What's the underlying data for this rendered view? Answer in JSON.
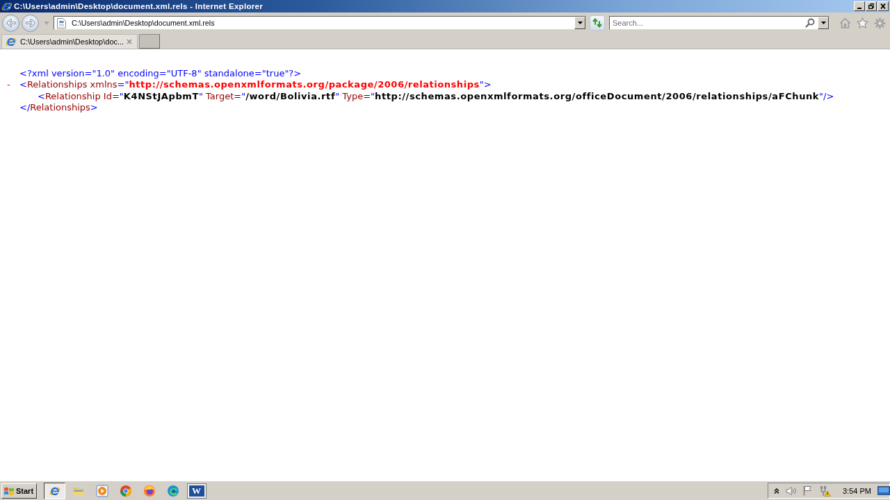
{
  "window": {
    "title": "C:\\Users\\admin\\Desktop\\document.xml.rels - Internet Explorer"
  },
  "address_bar": {
    "value": "C:\\Users\\admin\\Desktop\\document.xml.rels"
  },
  "search": {
    "placeholder": "Search..."
  },
  "tabs": [
    {
      "label": "C:\\Users\\admin\\Desktop\\doc...",
      "selected": true
    }
  ],
  "xml_view": {
    "lines": [
      {
        "tokens": [
          {
            "kind": "markup",
            "text": "<?xml version=\"1.0\" encoding=\"UTF-8\" standalone=\"true\"?>"
          }
        ]
      },
      {
        "toggle": "-",
        "tokens": [
          {
            "kind": "markup",
            "text": "<"
          },
          {
            "kind": "name",
            "text": "Relationships xmlns"
          },
          {
            "kind": "markup",
            "text": "=\""
          },
          {
            "kind": "namespace",
            "text": "http://schemas.openxmlformats.org/package/2006/relationships"
          },
          {
            "kind": "markup",
            "text": "\">"
          }
        ],
        "children": [
          {
            "tokens": [
              {
                "kind": "markup",
                "text": "<"
              },
              {
                "kind": "name",
                "text": "Relationship Id"
              },
              {
                "kind": "markup",
                "text": "=\""
              },
              {
                "kind": "value",
                "text": "K4NStJApbmT"
              },
              {
                "kind": "markup",
                "text": "\" "
              },
              {
                "kind": "name",
                "text": "Target"
              },
              {
                "kind": "markup",
                "text": "=\""
              },
              {
                "kind": "value",
                "text": "/word/Bolivia.rtf"
              },
              {
                "kind": "markup",
                "text": "\" "
              },
              {
                "kind": "name",
                "text": "Type"
              },
              {
                "kind": "markup",
                "text": "=\""
              },
              {
                "kind": "value",
                "text": "http://schemas.openxmlformats.org/officeDocument/2006/relationships/aFChunk"
              },
              {
                "kind": "markup",
                "text": "\"/>"
              }
            ]
          }
        ]
      },
      {
        "tokens": [
          {
            "kind": "markup",
            "text": "</"
          },
          {
            "kind": "name",
            "text": "Relationships"
          },
          {
            "kind": "markup",
            "text": ">"
          }
        ]
      }
    ]
  },
  "taskbar": {
    "start": "Start",
    "apps": [
      {
        "kind": "ie",
        "selected": true
      },
      {
        "kind": "explorer",
        "selected": false
      },
      {
        "kind": "media",
        "selected": false
      },
      {
        "kind": "chrome",
        "selected": false
      },
      {
        "kind": "firefox",
        "selected": false
      },
      {
        "kind": "edge",
        "selected": false
      },
      {
        "kind": "word",
        "label": "W",
        "selected": false
      }
    ],
    "clock": "3:54 PM"
  }
}
